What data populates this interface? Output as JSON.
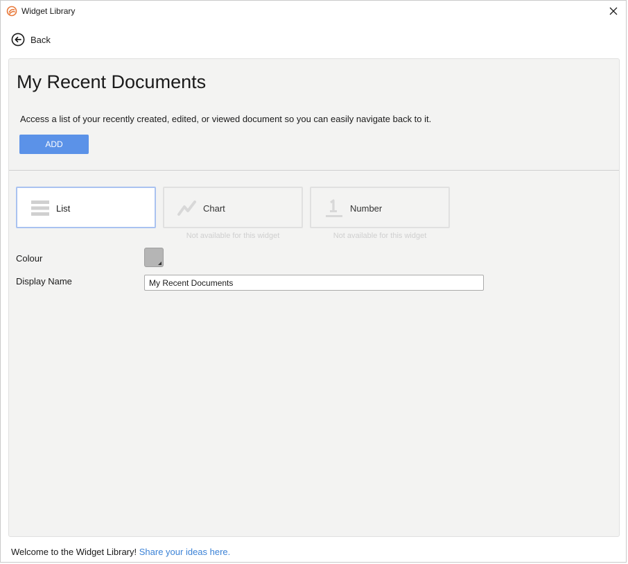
{
  "window": {
    "title": "Widget Library",
    "logo_icon": "smartsheet-logo",
    "close_icon": "close-icon"
  },
  "nav": {
    "back_label": "Back",
    "back_icon": "back-arrow-circle-icon"
  },
  "widget": {
    "title": "My Recent Documents",
    "description": "Access a list of your recently created, edited, or viewed document so you can easily navigate back to it.",
    "add_label": "ADD"
  },
  "view_types": [
    {
      "label": "List",
      "icon": "list-icon",
      "selected": true,
      "note": ""
    },
    {
      "label": "Chart",
      "icon": "line-chart-icon",
      "selected": false,
      "note": "Not available for this widget"
    },
    {
      "label": "Number",
      "icon": "number-icon",
      "selected": false,
      "note": "Not available for this widget"
    }
  ],
  "settings": {
    "colour_label": "Colour",
    "colour_value": "#b5b5b5",
    "display_name_label": "Display Name",
    "display_name_value": "My Recent Documents"
  },
  "footer": {
    "welcome_text": "Welcome to the Widget Library!",
    "link_text": "Share your ideas here."
  },
  "colors": {
    "accent": "#5b92e8",
    "link": "#3b82d6",
    "panel_bg": "#f3f3f2",
    "logo": "#e8793a"
  }
}
